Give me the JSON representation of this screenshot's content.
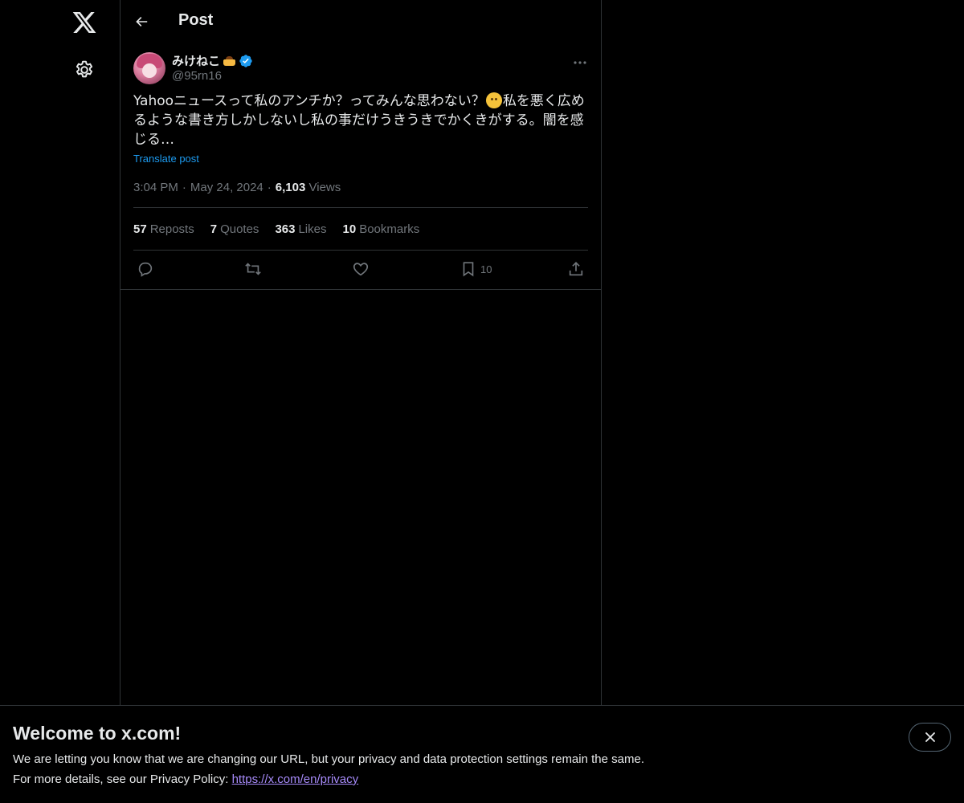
{
  "page": {
    "title": "Post"
  },
  "post": {
    "display_name": "みけねこ",
    "handle": "@95rn16",
    "text_part1": "Yahooニュースって私のアンチか？ってみんな思わない？",
    "text_part2": "私を悪く広めるような書き方しかしないし私の事だけうきうきでかくきがする。闇を感じる…",
    "translate_label": "Translate post",
    "time": "3:04 PM",
    "date": "May 24, 2024",
    "views_count": "6,103",
    "views_label": "Views",
    "icons": {
      "verified": "verified-badge-icon",
      "name_emoji": "pudding-emoji",
      "text_emoji": "confused-face-emoji"
    }
  },
  "stats": {
    "reposts_count": "57",
    "reposts_label": "Reposts",
    "quotes_count": "7",
    "quotes_label": "Quotes",
    "likes_count": "363",
    "likes_label": "Likes",
    "bookmarks_count": "10",
    "bookmarks_label": "Bookmarks"
  },
  "actions": {
    "bookmark_count": "10"
  },
  "banner": {
    "title": "Welcome to x.com!",
    "line1": "We are letting you know that we are changing our URL, but your privacy and data protection settings remain the same.",
    "line2_prefix": "For more details, see our Privacy Policy: ",
    "link": "https://x.com/en/privacy"
  },
  "colors": {
    "background": "#000000",
    "text": "#e7e9ea",
    "muted": "#71767b",
    "accent": "#1d9bf0",
    "border": "#2f3336"
  }
}
